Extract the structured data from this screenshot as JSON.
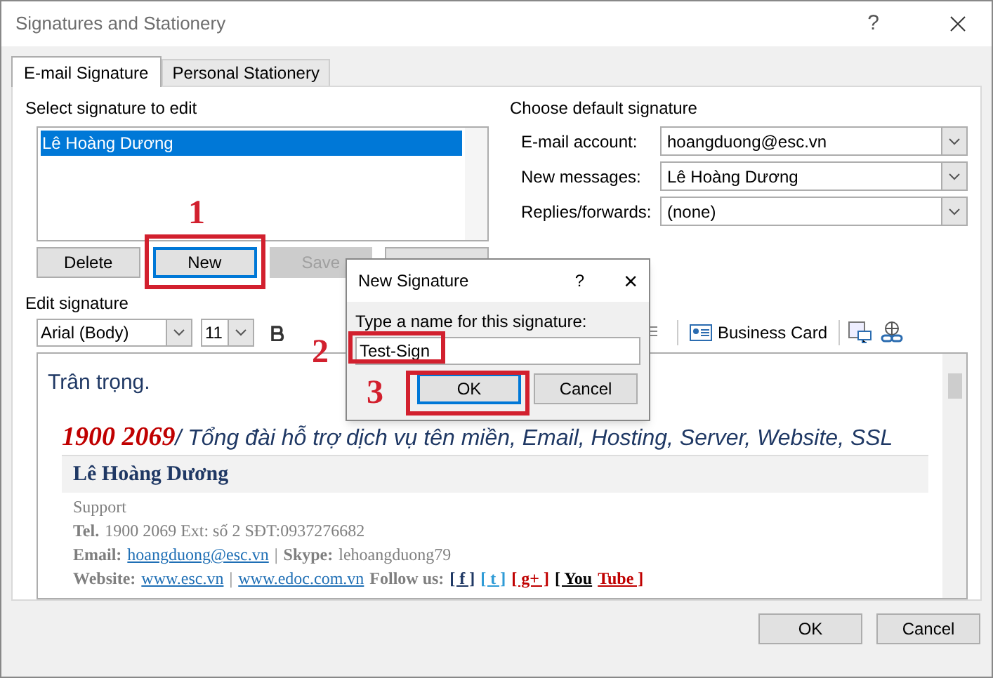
{
  "window": {
    "title": "Signatures and Stationery",
    "help": "?"
  },
  "tabs": [
    {
      "label": "E-mail Signature",
      "selected": true
    },
    {
      "label": "Personal Stationery",
      "selected": false
    }
  ],
  "select_section": {
    "title": "Select signature to edit",
    "items": [
      {
        "label": "Lê Hoàng Dương",
        "selected": true
      }
    ],
    "buttons": [
      {
        "label": "Delete",
        "disabled": false,
        "focused": false
      },
      {
        "label": "New",
        "disabled": false,
        "focused": true
      },
      {
        "label": "Save",
        "disabled": true,
        "focused": false
      },
      {
        "disabled": false,
        "focused": false
      }
    ]
  },
  "default_section": {
    "title": "Choose default signature",
    "fields": [
      {
        "label": "E-mail account:",
        "value": "hoangduong@esc.vn"
      },
      {
        "label": "New messages:",
        "value": "Lê Hoàng Dương"
      },
      {
        "label": "Replies/forwards:",
        "value": "(none)"
      }
    ]
  },
  "edit_section": {
    "title": "Edit signature",
    "font": "Arial (Body)",
    "size": "11",
    "business_card": "Business Card"
  },
  "signature": {
    "greeting": "Trân trọng.",
    "hotline": "1900 2069",
    "tagline": "/ Tổng đài hỗ trợ dịch vụ tên miền, Email, Hosting, Server, Website, SSL",
    "name": "Lê Hoàng Dương",
    "lines": [
      [
        {
          "kind": "text",
          "text": "Support"
        }
      ],
      [
        {
          "kind": "label",
          "text": "Tel."
        },
        {
          "kind": "text",
          "text": "1900 2069 Ext: số 2    SĐT:0937276682"
        }
      ],
      [
        {
          "kind": "label",
          "text": "Email:"
        },
        {
          "kind": "link",
          "text": "hoangduong@esc.vn"
        },
        {
          "kind": "text",
          "text": "|"
        },
        {
          "kind": "label",
          "text": "Skype:"
        },
        {
          "kind": "text",
          "text": "lehoangduong79"
        }
      ],
      [
        {
          "kind": "label",
          "text": "Website:"
        },
        {
          "kind": "link",
          "text": "www.esc.vn"
        },
        {
          "kind": "text",
          "text": "|"
        },
        {
          "kind": "link",
          "text": "www.edoc.com.vn"
        },
        {
          "kind": "label",
          "text": "Follow us:"
        },
        {
          "kind": "social",
          "text": "[ f ]",
          "color": "#1f3864"
        },
        {
          "kind": "social",
          "text": "[ t ]",
          "color": "#2e9bd6"
        },
        {
          "kind": "social",
          "text": "[ g+ ]",
          "color": "#c00000"
        },
        {
          "kind": "social",
          "text": "[ You",
          "color": "#000000"
        },
        {
          "kind": "social",
          "text": "Tube ]",
          "color": "#c00000"
        }
      ]
    ]
  },
  "dialog": {
    "title": "New Signature",
    "help": "?",
    "close": "×",
    "prompt": "Type a name for this signature:",
    "value": "Test-Sign",
    "ok": "OK",
    "cancel": "Cancel"
  },
  "annotations": [
    {
      "label": "1"
    },
    {
      "label": "2"
    },
    {
      "label": "3"
    }
  ],
  "footer": {
    "ok": "OK",
    "cancel": "Cancel"
  }
}
